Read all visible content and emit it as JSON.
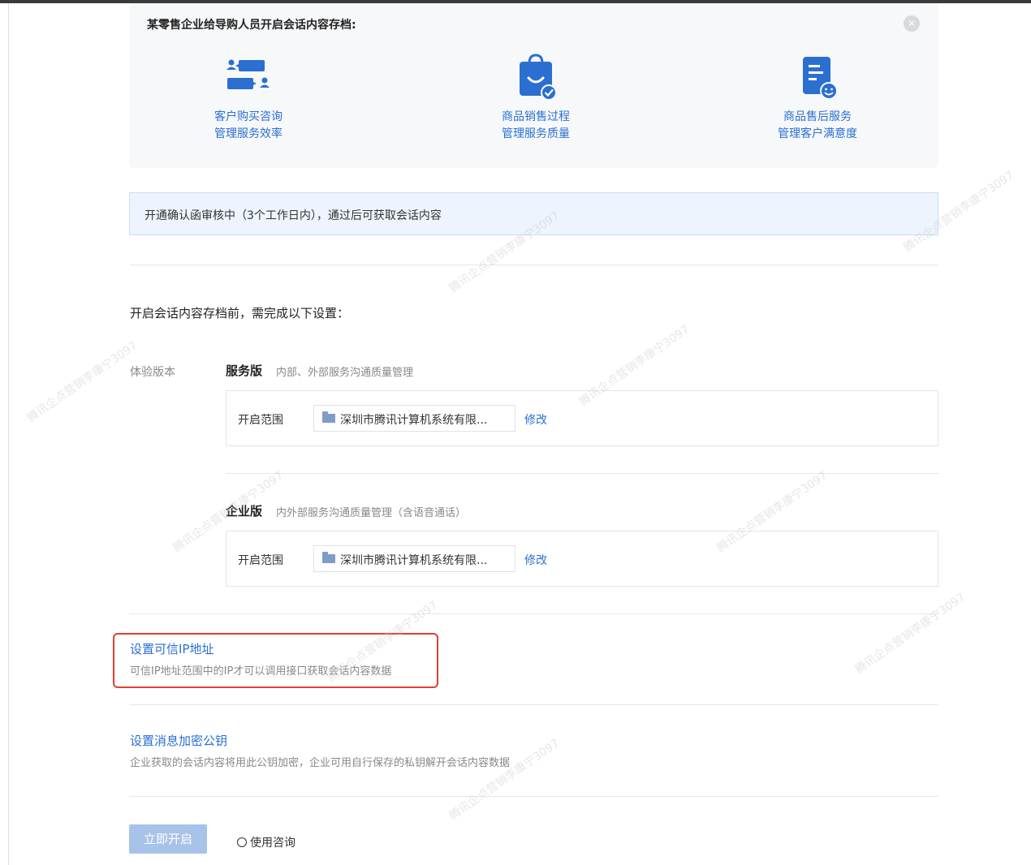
{
  "intro": {
    "title": "某零售企业给导购人员开启会话内容存档:",
    "features": [
      {
        "line1": "客户购买咨询",
        "line2": "管理服务效率",
        "icon": "chat-bubbles-icon"
      },
      {
        "line1": "商品销售过程",
        "line2": "管理服务质量",
        "icon": "shopping-bag-icon"
      },
      {
        "line1": "商品售后服务",
        "line2": "管理客户满意度",
        "icon": "document-smile-icon"
      }
    ]
  },
  "notice": {
    "text": "开通确认函审核中（3个工作日内），通过后可获取会话内容"
  },
  "prereq": {
    "text": "开启会话内容存档前，需完成以下设置："
  },
  "experience": {
    "label": "体验版本",
    "versions": [
      {
        "title": "服务版",
        "desc": "内部、外部服务沟通质量管理",
        "scope_label": "开启范围",
        "scope_value": "深圳市腾讯计算机系统有限...",
        "edit": "修改"
      },
      {
        "title": "企业版",
        "desc": "内外部服务沟通质量管理（含语音通话）",
        "scope_label": "开启范围",
        "scope_value": "深圳市腾讯计算机系统有限...",
        "edit": "修改"
      }
    ]
  },
  "trusted_ip": {
    "title": "设置可信IP地址",
    "desc": "可信IP地址范围中的IP才可以调用接口获取会话内容数据"
  },
  "encrypt_key": {
    "title": "设置消息加密公钥",
    "desc": "企业获取的会话内容将用此公钥加密，企业可用自行保存的私钥解开会话内容数据"
  },
  "actions": {
    "open": "立即开启",
    "consult": "使用咨询"
  },
  "watermark": {
    "text": "腾讯企点营销李康宁3097"
  },
  "colors": {
    "link": "#2b6fd1",
    "highlight": "#e0402f",
    "button_disabled": "#a8c3e9",
    "notice_bg": "#eef4fd"
  }
}
